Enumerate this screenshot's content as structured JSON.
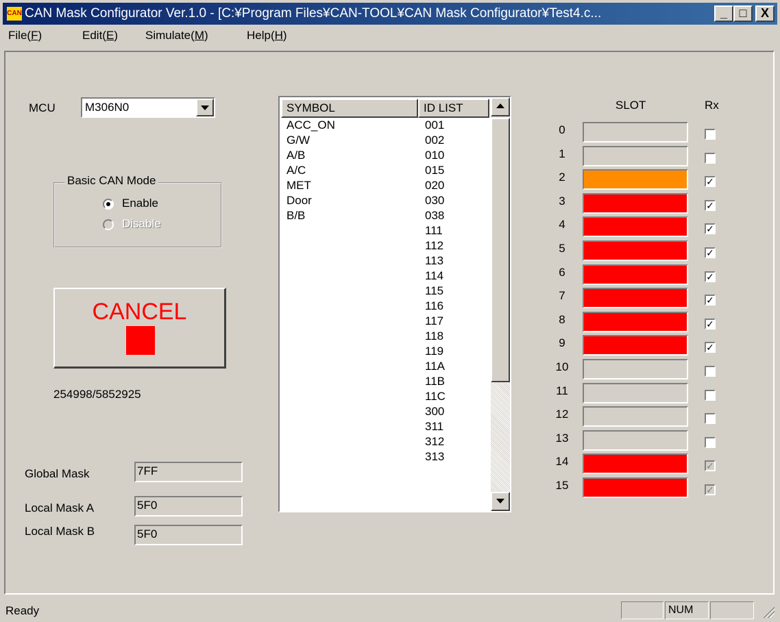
{
  "window": {
    "title": "CAN Mask Configurator Ver.1.0 - [C:¥Program Files¥CAN-TOOL¥CAN Mask Configurator¥Test4.c...",
    "app_icon_text": "CAN",
    "minimize": "_",
    "maximize": "□",
    "close": "X"
  },
  "menu": [
    {
      "label": "File",
      "accel": "F"
    },
    {
      "label": "Edit",
      "accel": "E"
    },
    {
      "label": "Simulate",
      "accel": "M"
    },
    {
      "label": "Help",
      "accel": "H"
    }
  ],
  "mcu": {
    "label": "MCU",
    "value": "M306N0"
  },
  "basic_can": {
    "title": "Basic CAN Mode",
    "enable": "Enable",
    "disable": "Disable",
    "selected": "Enable"
  },
  "cancel_button": {
    "label": "CANCEL",
    "indicator_color": "#ff0000"
  },
  "progress_text": "254998/5852925",
  "masks": {
    "global_label": "Global Mask",
    "global_value": "7FF",
    "local_a_label": "Local Mask A",
    "local_a_value": "5F0",
    "local_b_label": "Local Mask B",
    "local_b_value": "5F0"
  },
  "list": {
    "headers": {
      "symbol": "SYMBOL",
      "id": "ID LIST"
    },
    "symbols": [
      "ACC_ON",
      "G/W",
      "A/B",
      "A/C",
      "MET",
      "Door",
      "B/B"
    ],
    "ids": [
      "001",
      "002",
      "010",
      "015",
      "020",
      "030",
      "038",
      "111",
      "112",
      "113",
      "114",
      "115",
      "116",
      "117",
      "118",
      "119",
      "11A",
      "11B",
      "11C",
      "300",
      "311",
      "312",
      "313"
    ]
  },
  "slots": {
    "header": "SLOT",
    "rx_header": "Rx",
    "colors": {
      "empty": "#d4d0c8",
      "orange": "#ff8c00",
      "red": "#ff0000"
    },
    "items": [
      {
        "num": "0",
        "color": "empty",
        "rx": false,
        "rx_enabled": true
      },
      {
        "num": "1",
        "color": "empty",
        "rx": false,
        "rx_enabled": true
      },
      {
        "num": "2",
        "color": "orange",
        "rx": true,
        "rx_enabled": true
      },
      {
        "num": "3",
        "color": "red",
        "rx": true,
        "rx_enabled": true
      },
      {
        "num": "4",
        "color": "red",
        "rx": true,
        "rx_enabled": true
      },
      {
        "num": "5",
        "color": "red",
        "rx": true,
        "rx_enabled": true
      },
      {
        "num": "6",
        "color": "red",
        "rx": true,
        "rx_enabled": true
      },
      {
        "num": "7",
        "color": "red",
        "rx": true,
        "rx_enabled": true
      },
      {
        "num": "8",
        "color": "red",
        "rx": true,
        "rx_enabled": true
      },
      {
        "num": "9",
        "color": "red",
        "rx": true,
        "rx_enabled": true
      },
      {
        "num": "10",
        "color": "empty",
        "rx": false,
        "rx_enabled": true
      },
      {
        "num": "11",
        "color": "empty",
        "rx": false,
        "rx_enabled": true
      },
      {
        "num": "12",
        "color": "empty",
        "rx": false,
        "rx_enabled": true
      },
      {
        "num": "13",
        "color": "empty",
        "rx": false,
        "rx_enabled": true
      },
      {
        "num": "14",
        "color": "red",
        "rx": true,
        "rx_enabled": false
      },
      {
        "num": "15",
        "color": "red",
        "rx": true,
        "rx_enabled": false
      }
    ]
  },
  "status": {
    "text": "Ready",
    "num": "NUM"
  }
}
